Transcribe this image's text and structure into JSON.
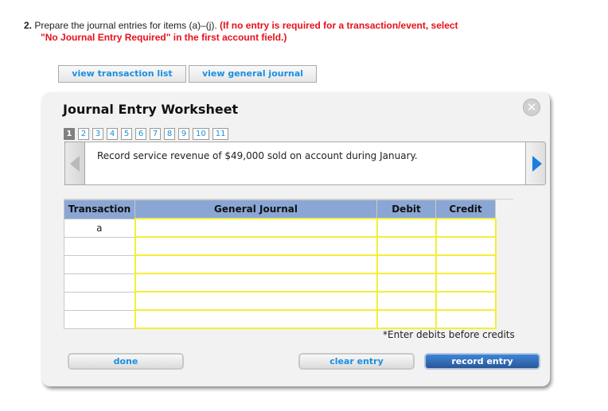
{
  "question": {
    "number": "2.",
    "text": "Prepare the journal entries for items (a)–(j).",
    "note_line1": "(If no entry is required for a transaction/event, select",
    "note_line2": "\"No Journal Entry Required\" in the first account field.)"
  },
  "top_buttons": {
    "view_transaction_list": "view transaction list",
    "view_general_journal": "view general journal"
  },
  "worksheet": {
    "title": "Journal Entry Worksheet",
    "close_icon": "close-icon",
    "tabs": [
      "1",
      "2",
      "3",
      "4",
      "5",
      "6",
      "7",
      "8",
      "9",
      "10",
      "11"
    ],
    "active_tab": "1",
    "description": "Record service revenue of $49,000 sold on account during January.",
    "table": {
      "headers": [
        "Transaction",
        "General Journal",
        "Debit",
        "Credit"
      ],
      "rows": [
        {
          "transaction": "a",
          "general_journal": "",
          "debit": "",
          "credit": ""
        },
        {
          "transaction": "",
          "general_journal": "",
          "debit": "",
          "credit": ""
        },
        {
          "transaction": "",
          "general_journal": "",
          "debit": "",
          "credit": ""
        },
        {
          "transaction": "",
          "general_journal": "",
          "debit": "",
          "credit": ""
        },
        {
          "transaction": "",
          "general_journal": "",
          "debit": "",
          "credit": ""
        },
        {
          "transaction": "",
          "general_journal": "",
          "debit": "",
          "credit": ""
        }
      ]
    },
    "hint": "*Enter debits before credits",
    "buttons": {
      "done": "done",
      "clear_entry": "clear entry",
      "record_entry": "record entry"
    }
  },
  "colors": {
    "link_blue": "#1a8fe0",
    "note_red": "#e8101a",
    "header_blue": "#8aa6d4",
    "field_yellow": "#f5ee38",
    "primary_button": "#2a5796"
  }
}
